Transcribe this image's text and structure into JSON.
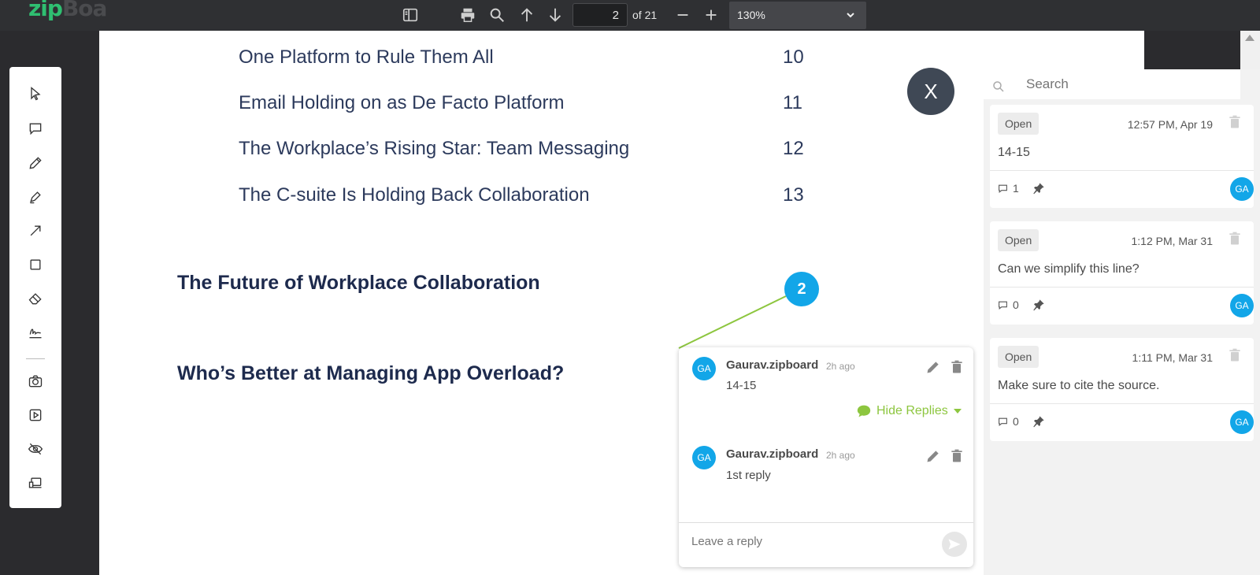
{
  "app": {
    "logo_main": "zip",
    "logo_rest": "Boa"
  },
  "toolbar": {
    "page_value": "2",
    "page_of": "of 21",
    "zoom": "130%"
  },
  "toc": [
    {
      "title": "One Platform to Rule Them All",
      "page": "10"
    },
    {
      "title": "Email Holding on as De Facto Platform",
      "page": "11"
    },
    {
      "title": "The Workplace’s Rising Star: Team Messaging",
      "page": "12"
    },
    {
      "title": "The C-suite Is Holding Back Collaboration",
      "page": "13"
    }
  ],
  "headings": [
    "The Future of Workplace Collaboration",
    "Who’s Better at Managing App Overload?"
  ],
  "close_label": "X",
  "marker_number": "2",
  "thread": {
    "comments": [
      {
        "initials": "GA",
        "author": "Gaurav.zipboard",
        "time": "2h ago",
        "text": "14-15"
      },
      {
        "initials": "GA",
        "author": "Gaurav.zipboard",
        "time": "2h ago",
        "text": "1st reply"
      }
    ],
    "hide_replies": "Hide Replies",
    "reply_placeholder": "Leave a reply"
  },
  "panel": {
    "search_placeholder": "Search",
    "cards": [
      {
        "status": "Open",
        "time": "12:57 PM, Apr 19",
        "text": "14-15",
        "count": "1",
        "initials": "GA"
      },
      {
        "status": "Open",
        "time": "1:12 PM, Mar 31",
        "text": "Can we simplify this line?",
        "count": "0",
        "initials": "GA"
      },
      {
        "status": "Open",
        "time": "1:11 PM, Mar 31",
        "text": "Make sure to cite the source.",
        "count": "0",
        "initials": "GA"
      }
    ]
  },
  "colors": {
    "accent_blue": "#12a6e8",
    "accent_green": "#8dc63f",
    "brand_green": "#2fbf71"
  }
}
